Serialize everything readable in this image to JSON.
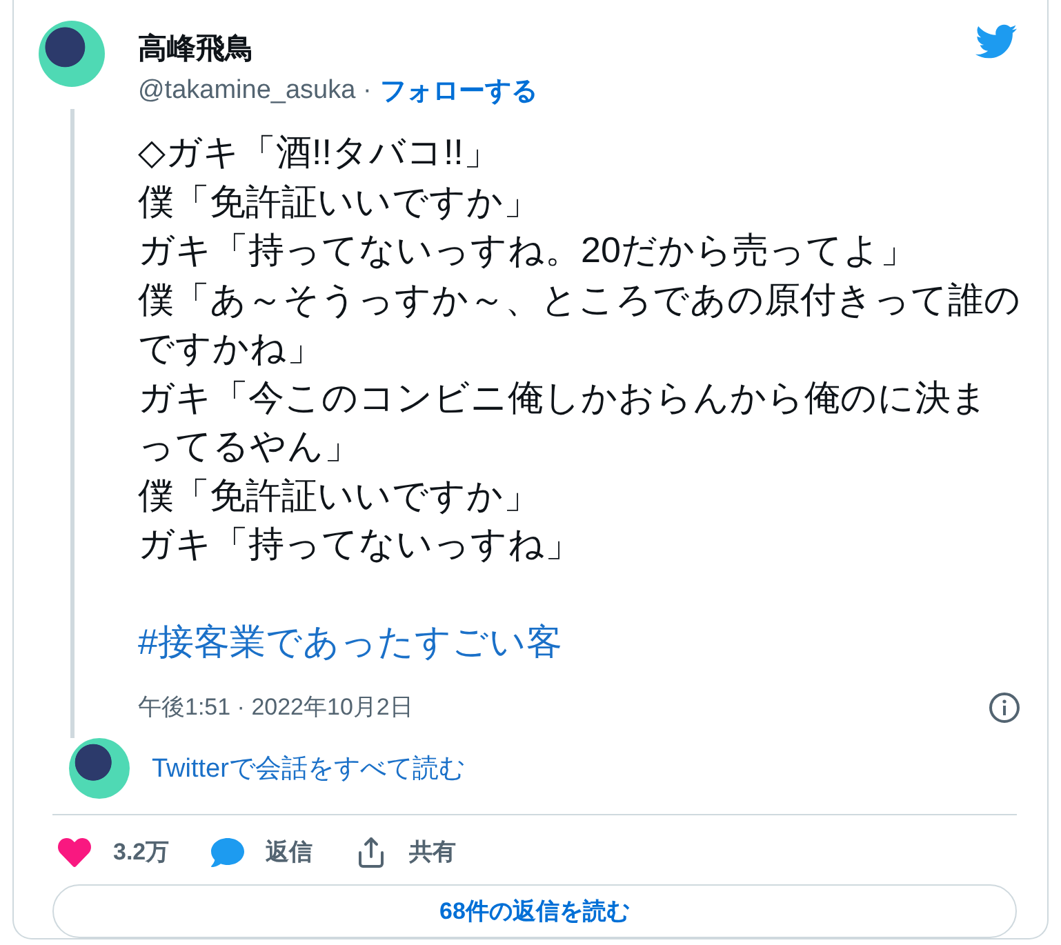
{
  "author": {
    "name": "高峰飛鳥",
    "handle": "@takamine_asuka",
    "separator": "·",
    "follow": "フォローする"
  },
  "body": {
    "lines": [
      "◇ガキ「酒!!タバコ!!」",
      "僕「免許証いいですか」",
      "ガキ「持ってないっすね。20だから売ってよ」",
      "僕「あ～そうっすか～、ところであの原付きって誰のですかね」",
      "ガキ「今このコンビニ俺しかおらんから俺のに決まってるやん」",
      "僕「免許証いいですか」",
      "ガキ「持ってないっすね」"
    ],
    "hashtag": "#接客業であったすごい客"
  },
  "timestamp": "午後1:51 · 2022年10月2日",
  "conversation_link": "Twitterで会話をすべて読む",
  "actions": [
    {
      "kind": "like",
      "label": "3.2万"
    },
    {
      "kind": "reply",
      "label": "返信"
    },
    {
      "kind": "share",
      "label": "共有"
    }
  ],
  "read_replies": "68件の返信を読む"
}
